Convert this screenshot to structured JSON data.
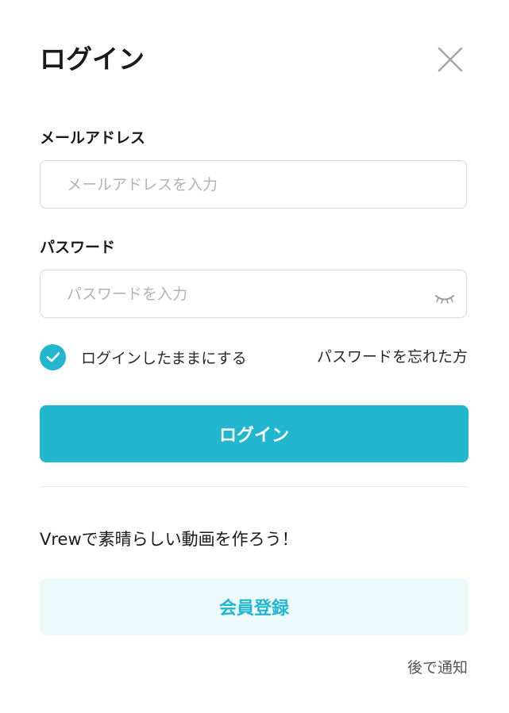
{
  "dialog": {
    "title": "ログイン",
    "close_icon": "close-icon"
  },
  "email": {
    "label": "メールアドレス",
    "placeholder": "メールアドレスを入力",
    "value": ""
  },
  "password": {
    "label": "パスワード",
    "placeholder": "パスワードを入力",
    "value": "",
    "toggle_icon": "eye-closed-icon"
  },
  "remember": {
    "label": "ログインしたままにする",
    "checked": true,
    "icon": "checkmark-icon"
  },
  "forgot_password": {
    "label": "パスワードを忘れた方"
  },
  "login_button": {
    "label": "ログイン"
  },
  "signup": {
    "promo_text": "Vrewで素晴らしい動画を作ろう！",
    "button_label": "会員登録"
  },
  "later": {
    "label": "後で通知"
  },
  "colors": {
    "accent": "#22b6cf",
    "signup_background": "#ecfafc",
    "border": "#d9d9d9",
    "placeholder": "#b3b3b3"
  }
}
